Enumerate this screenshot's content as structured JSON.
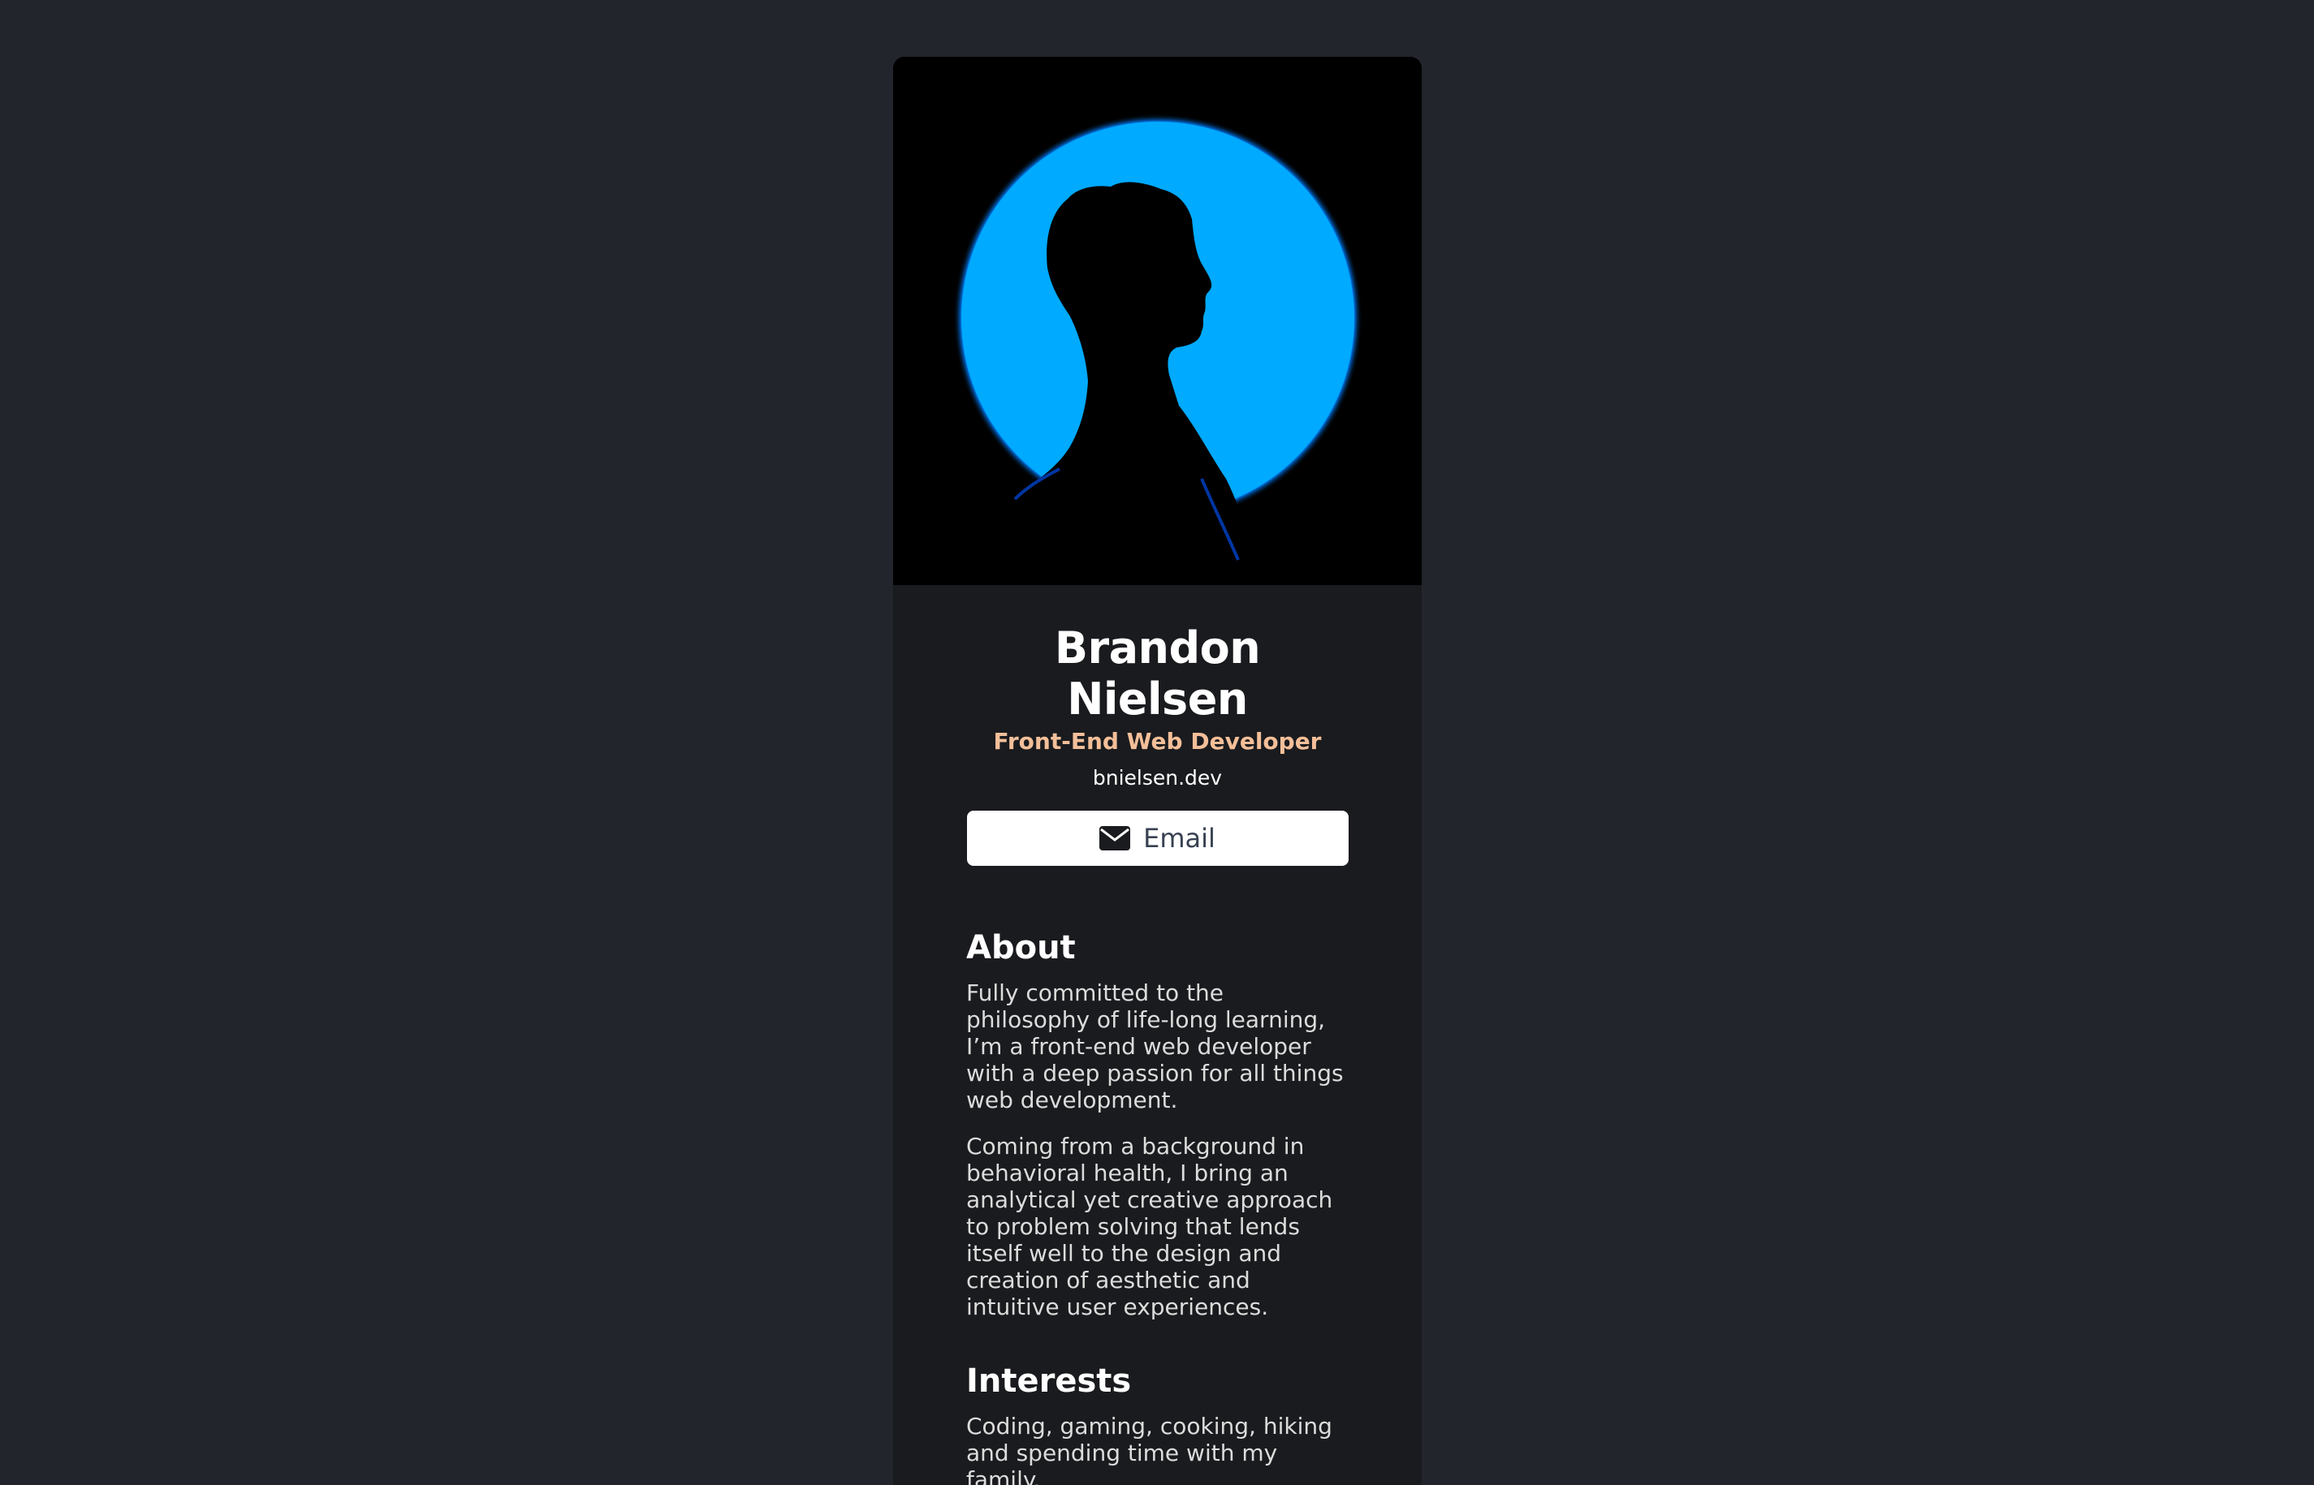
{
  "profile": {
    "name": "Brandon Nielsen",
    "title": "Front-End Web Developer",
    "website": "bnielsen.dev",
    "photo_icon": "profile-silhouette-photo"
  },
  "actions": {
    "email_label": "Email",
    "email_icon": "envelope-icon"
  },
  "about": {
    "heading": "About",
    "paragraphs": [
      "Fully committed to the philosophy of life-long learning, I’m a front-end web developer with a deep passion for all things web development.",
      "Coming from a background in behavioral health, I bring an analytical yet creative approach to problem solving that lends itself well to the design and creation of aesthetic and intuitive user experiences."
    ]
  },
  "interests": {
    "heading": "Interests",
    "text": "Coding, gaming, cooking, hiking and spending time with my family."
  },
  "colors": {
    "page_background": "#23252c",
    "card_background": "#1a1b1e",
    "accent": "#f3bf99",
    "photo_glow": "#00aaff"
  }
}
